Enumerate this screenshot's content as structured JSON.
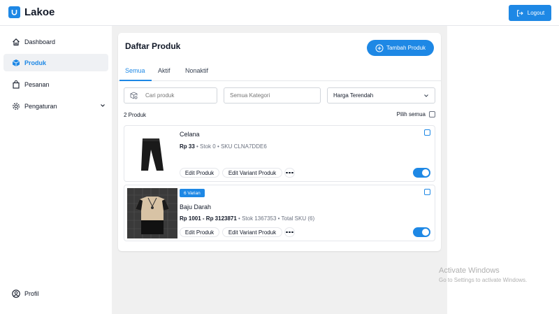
{
  "app": {
    "name": "Lakoe",
    "logout_label": "Logout"
  },
  "sidebar": {
    "items": [
      {
        "label": "Dashboard",
        "icon": "home-icon"
      },
      {
        "label": "Produk",
        "icon": "box-icon"
      },
      {
        "label": "Pesanan",
        "icon": "shopping-bag-icon"
      },
      {
        "label": "Pengaturan",
        "icon": "gear-icon"
      }
    ],
    "profile_label": "Profil"
  },
  "page": {
    "title": "Daftar Produk",
    "add_button": "Tambah Produk",
    "tabs": [
      "Semua",
      "Aktif",
      "Nonaktif"
    ],
    "active_tab": "Semua",
    "search_placeholder": "Cari produk",
    "category_placeholder": "Semua Kategori",
    "sort_value": "Harga Terendah",
    "count_label": "2 Produk",
    "select_all_label": "Pilih semua"
  },
  "products": [
    {
      "name": "Celana",
      "price": "Rp 33",
      "meta": " • Stok 0 • SKU CLNA7DDE6",
      "edit_label": "Edit Produk",
      "edit_variant_label": "Edit Variant Produk",
      "active": true
    },
    {
      "badge": "6 Varian",
      "name": "Baju Darah",
      "price": "Rp 1001 - Rp 3123871",
      "meta": " • Stok 1367353 • Total SKU (6)",
      "edit_label": "Edit Produk",
      "edit_variant_label": "Edit Variant Produk",
      "active": true
    }
  ],
  "watermark": {
    "line1": "Activate Windows",
    "line2": "Go to Settings to activate Windows."
  },
  "colors": {
    "accent": "#1e88e5",
    "main_bg": "#f0f0f0",
    "active_nav_bg": "#eff1f4"
  }
}
